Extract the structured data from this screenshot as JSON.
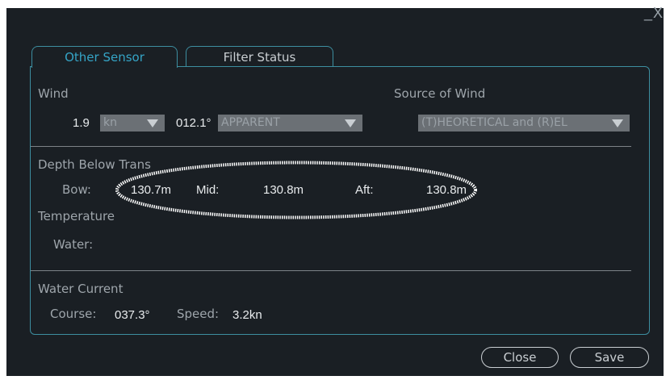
{
  "window": {
    "controls": "_X"
  },
  "tabs": [
    {
      "label": "Other Sensor",
      "active": true
    },
    {
      "label": "Filter Status",
      "active": false
    }
  ],
  "wind": {
    "label": "Wind",
    "speed_value": "1.9",
    "speed_unit": "kn",
    "direction_value": "012.1°",
    "mode": "APPARENT"
  },
  "source_of_wind": {
    "label": "Source of Wind",
    "value": "(T)HEORETICAL and (R)EL"
  },
  "depth": {
    "label": "Depth Below Trans",
    "bow_label": "Bow:",
    "bow_value": "130.7m",
    "mid_label": "Mid:",
    "mid_value": "130.8m",
    "aft_label": "Aft:",
    "aft_value": "130.8m"
  },
  "temperature": {
    "label": "Temperature",
    "water_label": "Water:"
  },
  "water_current": {
    "label": "Water Current",
    "course_label": "Course:",
    "course_value": "037.3°",
    "speed_label": "Speed:",
    "speed_value": "3.2kn"
  },
  "buttons": {
    "close": "Close",
    "save": "Save"
  },
  "colors": {
    "background": "#1a1f24",
    "accent": "#35a4c6",
    "border": "#3d8ea0",
    "dropdown": "#6b7075"
  }
}
